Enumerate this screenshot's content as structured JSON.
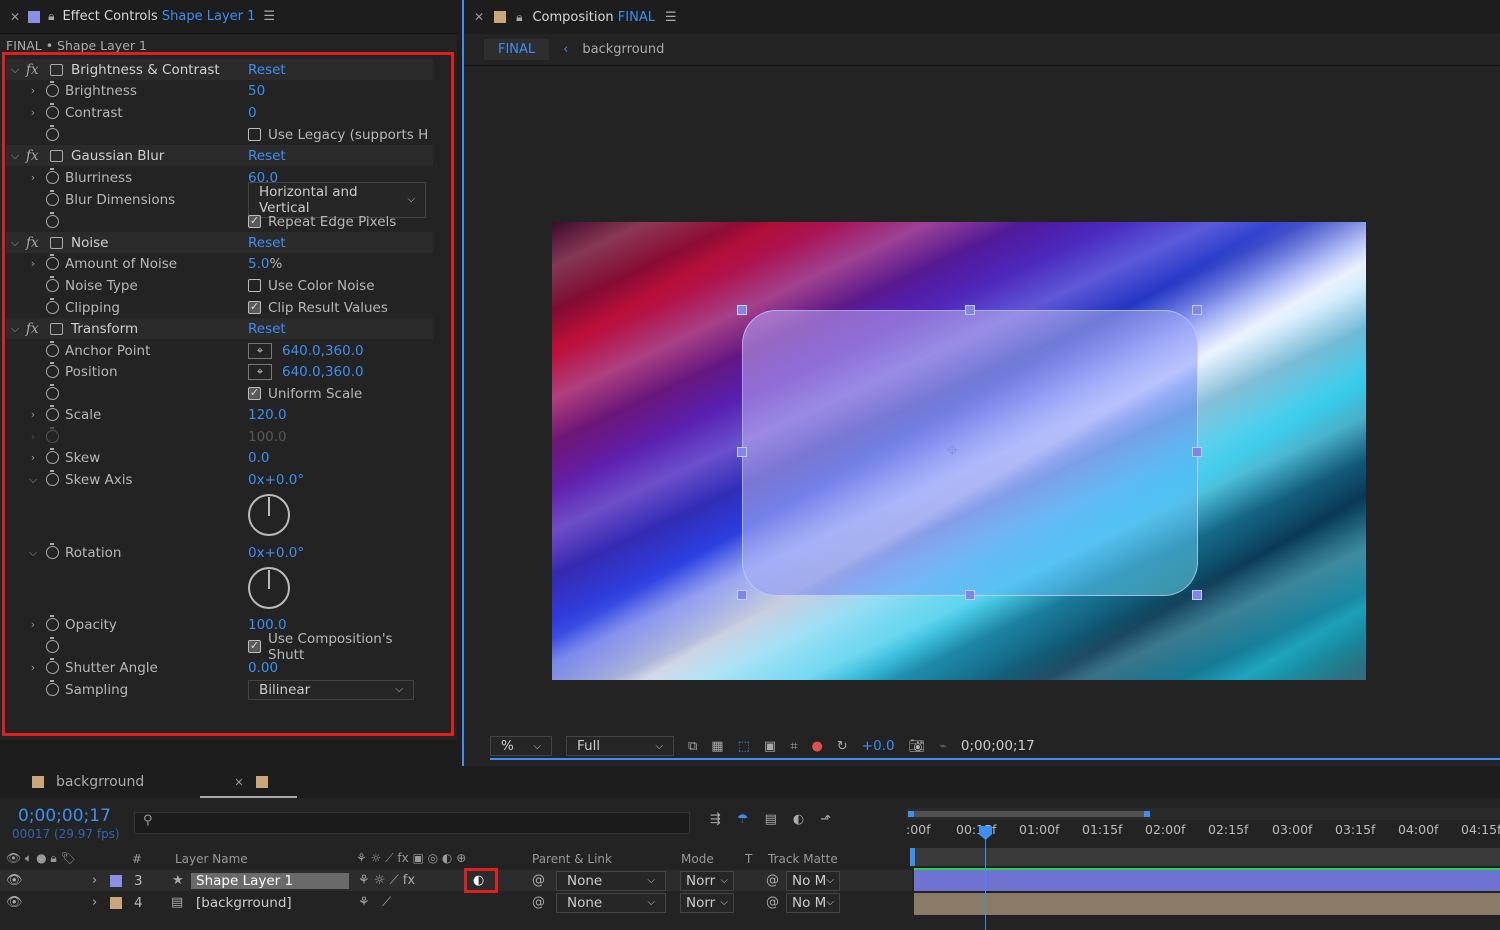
{
  "ec": {
    "title": "Effect Controls",
    "layer": "Shape Layer 1",
    "path": "FINAL • Shape Layer 1",
    "bc": {
      "name": "Brightness & Contrast",
      "reset": "Reset",
      "brightness_label": "Brightness",
      "brightness": "50",
      "contrast_label": "Contrast",
      "contrast": "0",
      "legacy": "Use Legacy (supports H"
    },
    "gb": {
      "name": "Gaussian Blur",
      "reset": "Reset",
      "blurriness_label": "Blurriness",
      "blurriness": "60.0",
      "dim_label": "Blur Dimensions",
      "dim": "Horizontal and Vertical",
      "repeat": "Repeat Edge Pixels"
    },
    "noise": {
      "name": "Noise",
      "reset": "Reset",
      "amount_label": "Amount of Noise",
      "amount": "5.0",
      "unit": "%",
      "type_label": "Noise Type",
      "color_noise": "Use Color Noise",
      "clip_label": "Clipping",
      "clip": "Clip Result Values"
    },
    "tr": {
      "name": "Transform",
      "reset": "Reset",
      "anchor_label": "Anchor Point",
      "anchor": "640.0,360.0",
      "pos_label": "Position",
      "pos": "640.0,360.0",
      "uniform": "Uniform Scale",
      "scale_label": "Scale",
      "scale": "120.0",
      "scale2": "100.0",
      "skew_label": "Skew",
      "skew": "0.0",
      "skewaxis_label": "Skew Axis",
      "skewaxis": "0x+0.0°",
      "rot_label": "Rotation",
      "rot": "0x+0.0°",
      "opacity_label": "Opacity",
      "opacity": "100.0",
      "shutter": "Use Composition's Shutt",
      "shutterangle_label": "Shutter Angle",
      "shutterangle": "0.00",
      "sampling_label": "Sampling",
      "sampling": "Bilinear"
    }
  },
  "comp": {
    "title": "Composition",
    "name": "FINAL",
    "crumb_active": "FINAL",
    "crumb_next": "backgrround",
    "zoom": "%",
    "resolution": "Full",
    "exposure": "+0.0",
    "timecode": "0;00;00;17"
  },
  "timeline": {
    "tab1": "backgrround",
    "time": "0;00;00;17",
    "frames": "00017 (29.97 fps)",
    "search_placeholder": "",
    "cols": {
      "num": "#",
      "name": "Layer Name",
      "parent": "Parent & Link",
      "mode": "Mode",
      "t": "T",
      "matte": "Track Matte"
    },
    "ruler": [
      ":00f",
      "00:15f",
      "01:00f",
      "01:15f",
      "02:00f",
      "02:15f",
      "03:00f",
      "03:15f",
      "04:00f",
      "04:15f"
    ],
    "layers": [
      {
        "num": "3",
        "name": "Shape Layer 1",
        "parent": "None",
        "mode": "Norr",
        "matte": "No M",
        "color": "#8a8fe8"
      },
      {
        "num": "4",
        "name": "[backgrround]",
        "parent": "None",
        "mode": "Norr",
        "matte": "No M",
        "color": "#c9a77a"
      }
    ]
  },
  "colors": {
    "accent": "#3f8ff0",
    "highlight_red": "#e02020",
    "timeline_shape": "#6f72cf",
    "timeline_bg": "#8a7b66",
    "playhead": "#3f8ff0"
  }
}
